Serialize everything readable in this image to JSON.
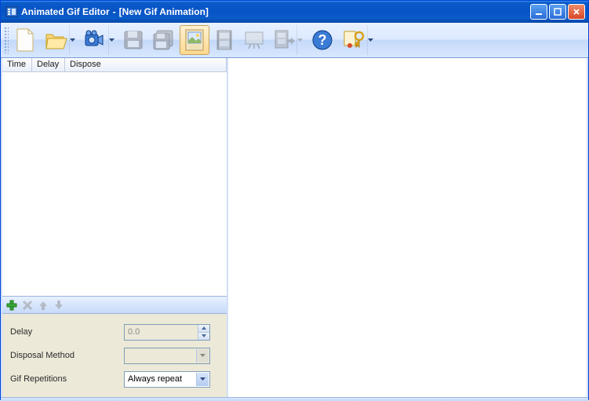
{
  "window": {
    "app_title": "Animated Gif Editor",
    "separator": " - ",
    "doc_title": "[New Gif Animation]"
  },
  "toolbar": {
    "items": [
      {
        "name": "new-file",
        "icon": "file-new",
        "enabled": true,
        "dropdown": false
      },
      {
        "name": "open-file",
        "icon": "folder-open",
        "enabled": true,
        "dropdown": true
      },
      {
        "name": "video-source",
        "icon": "video-camera",
        "enabled": true,
        "dropdown": true
      },
      {
        "name": "save",
        "icon": "floppy",
        "enabled": false,
        "dropdown": false
      },
      {
        "name": "save-as",
        "icon": "floppy-multi",
        "enabled": false,
        "dropdown": false
      },
      {
        "name": "frame-image",
        "icon": "image-frame",
        "enabled": true,
        "dropdown": false,
        "selected": true
      },
      {
        "name": "film",
        "icon": "film-strip",
        "enabled": false,
        "dropdown": false
      },
      {
        "name": "presentation",
        "icon": "screen",
        "enabled": false,
        "dropdown": false
      },
      {
        "name": "export",
        "icon": "film-arrow",
        "enabled": false,
        "dropdown": true
      },
      {
        "name": "help",
        "icon": "help",
        "enabled": true,
        "dropdown": false
      },
      {
        "name": "license",
        "icon": "key-cert",
        "enabled": true,
        "dropdown": true
      }
    ]
  },
  "table": {
    "columns": {
      "time": "Time",
      "delay": "Delay",
      "dispose": "Dispose"
    },
    "rows": []
  },
  "frame_actions": {
    "add": {
      "enabled": true
    },
    "remove": {
      "enabled": false
    },
    "up": {
      "enabled": false
    },
    "down": {
      "enabled": false
    }
  },
  "props": {
    "delay": {
      "label": "Delay",
      "value": "0.0",
      "enabled": false
    },
    "disposal": {
      "label": "Disposal Method",
      "value": "",
      "enabled": false
    },
    "repetitions": {
      "label": "Gif Repetitions",
      "value": "Always repeat",
      "enabled": true
    }
  }
}
